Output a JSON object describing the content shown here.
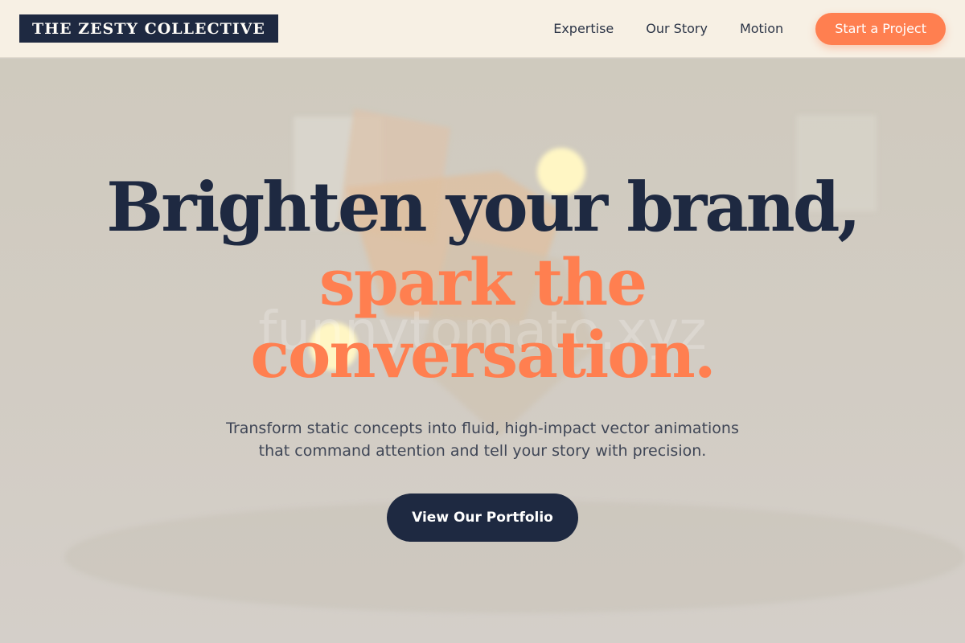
{
  "header": {
    "logo": "THE ZESTY COLLECTIVE",
    "nav": [
      {
        "label": "Expertise"
      },
      {
        "label": "Our Story"
      },
      {
        "label": "Motion"
      }
    ],
    "cta_label": "Start a Project"
  },
  "hero": {
    "watermark": "funnytomato.xyz",
    "headline_line1": "Brighten your brand,",
    "headline_line2": "spark the",
    "headline_line3": "conversation.",
    "subtitle_line1": "Transform static concepts into fluid, high-impact vector animations",
    "subtitle_line2": "that command attention and tell your story with precision.",
    "button_label": "View Our Portfolio"
  },
  "colors": {
    "navy": "#1e2941",
    "coral": "#ff7f50",
    "cream": "#f7f0e4",
    "glow": "#fff6c4"
  }
}
